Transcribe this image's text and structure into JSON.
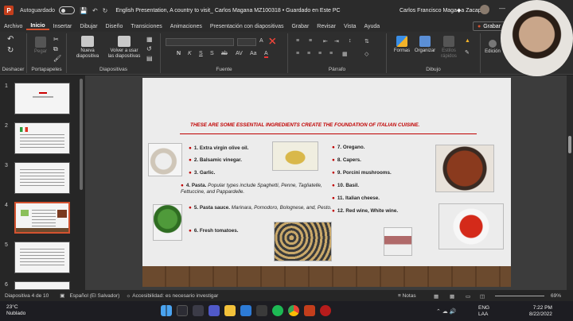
{
  "titlebar": {
    "autosave": "Autoguardado",
    "document_title": "English Presentation, A country to visit_ Carlos Magana MZ100318 • Guardado en Este PC",
    "user": "Carlos Francisco Maga◆a Zacapa"
  },
  "tabs": [
    "Archivo",
    "Inicio",
    "Insertar",
    "Dibujar",
    "Diseño",
    "Transiciones",
    "Animaciones",
    "Presentación con diapositivas",
    "Grabar",
    "Revisar",
    "Vista",
    "Ayuda"
  ],
  "share_label": "Grabar",
  "ribbon": {
    "undo_label": "Deshacer",
    "clipboard_label": "Portapapeles",
    "paste_label": "Pegar",
    "slides_label": "Diapositivas",
    "new_slide_label": "Nueva diapositiva",
    "reuse_label": "Volver a usar las diapositivas",
    "font_label": "Fuente",
    "paragraph_label": "Párrafo",
    "drawing_label": "Dibujo",
    "shapes_label": "Formas",
    "arrange_label": "Organizar",
    "quick_styles_label": "Estilos rápidos",
    "edit_label": "Edición",
    "font_buttons": [
      "N",
      "K",
      "S",
      "S",
      "ab",
      "AV",
      "Aa",
      "A",
      "A"
    ]
  },
  "thumbnails": [
    {
      "num": "1",
      "selected": false
    },
    {
      "num": "2",
      "selected": false
    },
    {
      "num": "3",
      "selected": false
    },
    {
      "num": "4",
      "selected": true
    },
    {
      "num": "5",
      "selected": false
    },
    {
      "num": "6",
      "selected": false
    }
  ],
  "slide": {
    "title": "THESE ARE SOME ESSENTIAL INGREDIENTS CREATE THE FOUNDATION OF ITALIAN CUISINE.",
    "left_items": [
      {
        "num": "1.",
        "name": "Extra virgin olive oil.",
        "desc": ""
      },
      {
        "num": "2.",
        "name": "Balsamic vinegar.",
        "desc": ""
      },
      {
        "num": "3.",
        "name": "Garlic.",
        "desc": ""
      },
      {
        "num": "4.",
        "name": "Pasta.",
        "desc": "Popular types include Spaghetti, Penne, Tagliatelle, Fettuccine, and Pappardelle."
      },
      {
        "num": "5.",
        "name": "Pasta sauce.",
        "desc": "Marinara, Pomodoro, Bolognese, and, Pesto."
      },
      {
        "num": "6.",
        "name": "Fresh tomatoes.",
        "desc": ""
      }
    ],
    "right_items": [
      {
        "num": "7.",
        "name": "Oregano."
      },
      {
        "num": "8.",
        "name": "Capers."
      },
      {
        "num": "9.",
        "name": "Porcini mushrooms."
      },
      {
        "num": "10.",
        "name": "Basil."
      },
      {
        "num": "11.",
        "name": "Italian cheese."
      },
      {
        "num": "12.",
        "name": "Red wine, White wine."
      }
    ]
  },
  "status": {
    "slide_count": "Diapositiva 4 de 10",
    "language": "Español (El Salvador)",
    "accessibility": "Accesibilidad: es necesario investigar",
    "notes": "Notas",
    "zoom": "69%"
  },
  "taskbar": {
    "temperature": "23°C",
    "condition": "Nublado",
    "lang1": "ENG",
    "lang2": "LAA",
    "time": "7:22 PM",
    "date": "8/22/2022"
  }
}
